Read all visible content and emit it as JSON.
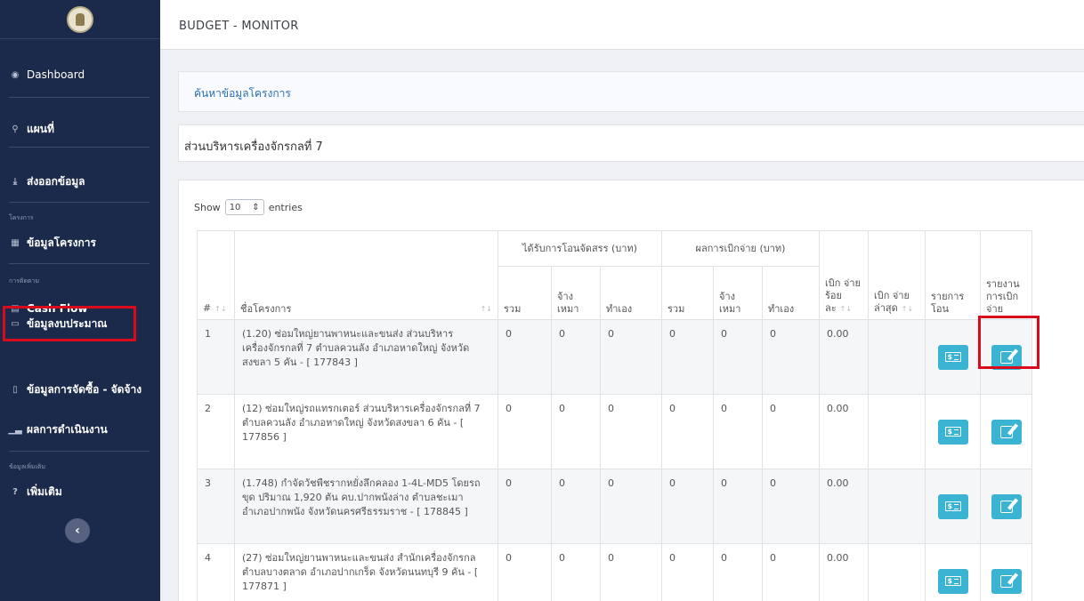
{
  "app": {
    "title": "BUDGET - MONITOR"
  },
  "sidebar": {
    "items": [
      {
        "label": "Dashboard",
        "icon": "dashboard-icon"
      },
      {
        "label": "แผนที่",
        "icon": "map-pin-icon"
      },
      {
        "label": "ส่งออกข้อมูล",
        "icon": "download-icon"
      },
      {
        "label": "ข้อมูลโครงการ",
        "icon": "table-icon"
      },
      {
        "label": "Cash Flow",
        "icon": "cash-flow-icon"
      },
      {
        "label": "ข้อมูลงบประมาณ",
        "icon": "money-icon"
      },
      {
        "label": "ข้อมูลการจัดซื้อ - จัดจ้าง",
        "icon": "document-icon"
      },
      {
        "label": "ผลการดำเนินงาน",
        "icon": "chart-icon"
      },
      {
        "label": "เพิ่มเติม",
        "icon": "help-icon"
      }
    ],
    "groups": {
      "project": "โครงการ",
      "tracking": "การติดตาม",
      "more": "ข้อมูลเพิ่มเติม"
    },
    "collapse": "‹"
  },
  "search_panel": {
    "link": "ค้นหาข้อมูลโครงการ"
  },
  "agency": {
    "name": "ส่วนบริหารเครื่องจักรกลที่ 7"
  },
  "table_controls": {
    "show": "Show",
    "entries_value": "10",
    "entries": "entries"
  },
  "table": {
    "headers": {
      "num": "#",
      "name": "ชื่อโครงการ",
      "allocated": "ได้รับการโอนจัดสรร (บาท)",
      "disbursed": "ผลการเบิกจ่าย (บาท)",
      "sum": "รวม",
      "hire": "จ้าง เหมา",
      "self": "ทำเอง",
      "pct": "เบิก จ่าย ร้อย ละ",
      "latest": "เบิก จ่าย ล่าสุด",
      "transfer": "รายการ โอน",
      "report": "รายงาน การเบิก จ่าย"
    },
    "rows": [
      {
        "num": "1",
        "name": "(1.20) ซ่อมใหญ่ยานพาหนะและขนส่ง ส่วนบริหารเครื่องจักรกลที่ 7 ตำบลควนลัง อำเภอหาดใหญ่ จังหวัดสงขลา 5 คัน - [ 177843 ]",
        "a_sum": "0",
        "a_hire": "0",
        "a_self": "0",
        "d_sum": "0",
        "d_hire": "0",
        "d_self": "0",
        "pct": "0.00",
        "latest": ""
      },
      {
        "num": "2",
        "name": "(12) ซ่อมใหญ่รถแทรกเตอร์ ส่วนบริหารเครื่องจักรกลที่ 7 ตำบลควนลัง อำเภอหาดใหญ่ จังหวัดสงขลา 6 คัน - [ 177856 ]",
        "a_sum": "0",
        "a_hire": "0",
        "a_self": "0",
        "d_sum": "0",
        "d_hire": "0",
        "d_self": "0",
        "pct": "0.00",
        "latest": ""
      },
      {
        "num": "3",
        "name": "(1.748) กำจัดวัชพืชรากหยั่งลึกคลอง 1-4L-MD5 โดยรถขุด ปริมาณ 1,920 ตัน คบ.ปากพนังล่าง ตำบลชะเมา อำเภอปากพนัง จังหวัดนครศรีธรรมราช - [ 178845 ]",
        "a_sum": "0",
        "a_hire": "0",
        "a_self": "0",
        "d_sum": "0",
        "d_hire": "0",
        "d_self": "0",
        "pct": "0.00",
        "latest": ""
      },
      {
        "num": "4",
        "name": "(27) ซ่อมใหญ่ยานพาหนะและขนส่ง สำนักเครื่องจักรกล ตำบลบางตลาด อำเภอปากเกร็ด จังหวัดนนทบุรี 9 คัน - [ 177871 ]",
        "a_sum": "0",
        "a_hire": "0",
        "a_self": "0",
        "d_sum": "0",
        "d_hire": "0",
        "d_self": "0",
        "pct": "0.00",
        "latest": ""
      }
    ]
  },
  "colors": {
    "sidebar_bg": "#1b2a4a",
    "button": "#3bb4d4",
    "highlight": "#d90a1b",
    "link": "#2a6fb3"
  }
}
